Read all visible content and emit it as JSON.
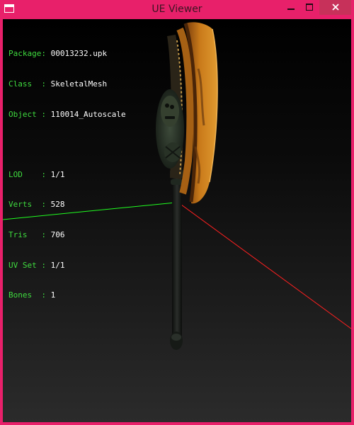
{
  "window": {
    "title": "UE Viewer",
    "controls": {
      "minimize": "minimize-icon",
      "maximize": "maximize-icon",
      "close": "close-icon"
    }
  },
  "info": {
    "package": {
      "label": "Package:",
      "value": "00013232.upk"
    },
    "class": {
      "label": "Class  :",
      "value": "SkeletalMesh"
    },
    "object": {
      "label": "Object :",
      "value": "110014_Autoscale"
    },
    "lod": {
      "label": "LOD    :",
      "value": "1/1"
    },
    "verts": {
      "label": "Verts  :",
      "value": "528"
    },
    "tris": {
      "label": "Tris   :",
      "value": "706"
    },
    "uvset": {
      "label": "UV Set :",
      "value": "1/1"
    },
    "bones": {
      "label": "Bones  :",
      "value": "1"
    }
  },
  "colors": {
    "frame": "#e8206a",
    "close_button": "#c7315a",
    "info_label": "#3fdc3f",
    "info_value": "#ffffff",
    "axis_x": "#ff2020",
    "axis_y": "#20ff20",
    "axe_blade": "#c97a1a"
  }
}
